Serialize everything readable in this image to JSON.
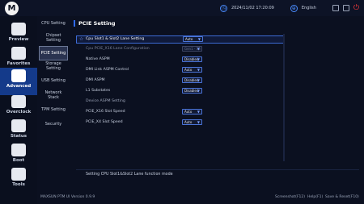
{
  "app": {
    "logo_letter": "M"
  },
  "topbar": {
    "datetime": "2024/11/02 17:20:09",
    "language": "English"
  },
  "nav": [
    {
      "label": "Preview",
      "icon": "monitor-icon"
    },
    {
      "label": "Favorites",
      "icon": "star-icon"
    },
    {
      "label": "Advanced",
      "icon": "advanced-icon"
    },
    {
      "label": "Overclock",
      "icon": "gauge-icon"
    },
    {
      "label": "Status",
      "icon": "status-icon"
    },
    {
      "label": "Boot",
      "icon": "boot-icon"
    },
    {
      "label": "Tools",
      "icon": "tools-icon"
    }
  ],
  "subnav": [
    {
      "label": "CPU Setting"
    },
    {
      "label": "Chipset Setting"
    },
    {
      "label": "PCIE Setting"
    },
    {
      "label": "Storage Setting"
    },
    {
      "label": "USB Setting"
    },
    {
      "label": "Network Stack"
    },
    {
      "label": "TPM Setting"
    },
    {
      "label": "Security"
    }
  ],
  "main": {
    "title": "PCIE Setting",
    "rows": [
      {
        "label": "Cpu Slot1 & Slot2 Lane Setting",
        "value": "Auto"
      },
      {
        "label": "Cpu PCIE_X16 Lane Configuration",
        "value": "Gen1 - 16"
      },
      {
        "label": "Native ASPM",
        "value": "Disabled"
      },
      {
        "label": "DMI Link ASPM Control",
        "value": "Auto"
      },
      {
        "label": "DMI ASPM",
        "value": "Disabled"
      },
      {
        "label": "L1 Substates",
        "value": "Disabled"
      },
      {
        "label": "Device ASPM Setting"
      },
      {
        "label": "PCIE_X16 Slot Speed",
        "value": "Auto"
      },
      {
        "label": "PCIE_X4 Slot Speed",
        "value": "Auto"
      }
    ],
    "help": "Setting CPU Slot1&Slot2 Lane function mode"
  },
  "bottombar": {
    "version": "MAXSUN PTM UI Version 0.9.9",
    "hotkeys": [
      "Screenshot(F12)",
      "Help(F1)",
      "Save & Reset(F10)"
    ]
  },
  "colors": {
    "accent": "#2f6bff",
    "active_nav": "#143a8a",
    "power": "#ff3b3b"
  }
}
